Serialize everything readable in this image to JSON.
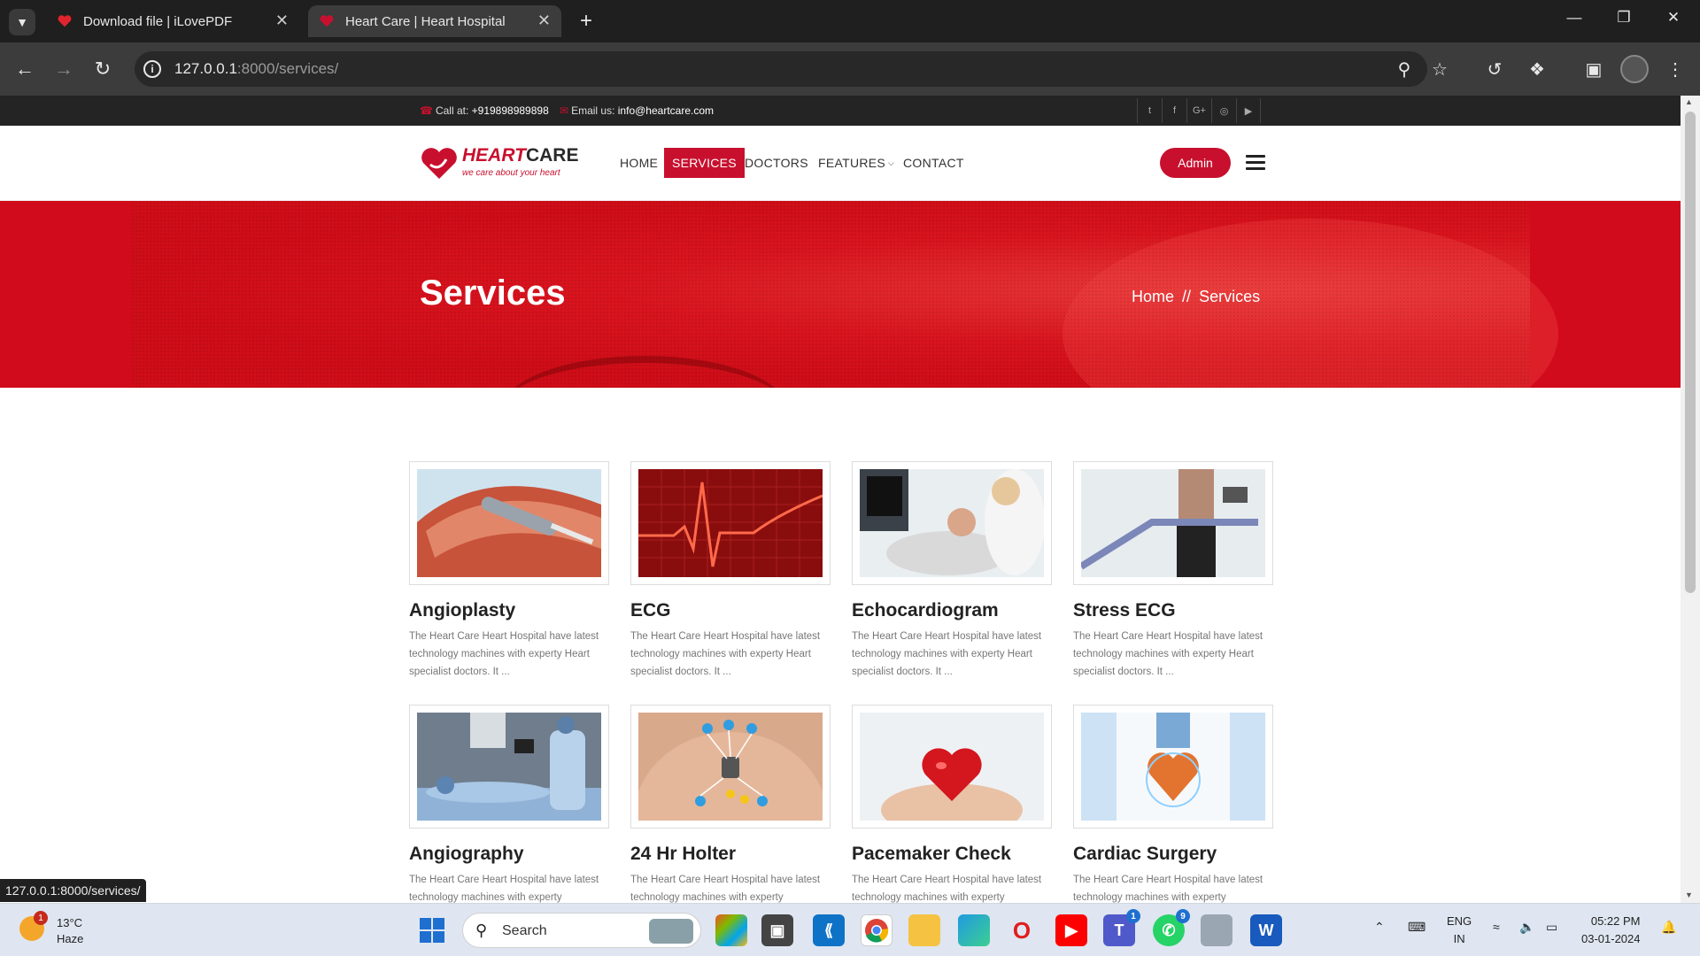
{
  "browser": {
    "tabs": [
      {
        "title": "Download file | iLovePDF",
        "active": false
      },
      {
        "title": "Heart Care | Heart Hospital",
        "active": true
      }
    ],
    "url_host": "127.0.0.1",
    "url_path": ":8000/services/",
    "status_url": "127.0.0.1:8000/services/"
  },
  "topbar": {
    "call_label": "Call at:",
    "call_number": "+919898989898",
    "email_label": "Email us:",
    "email": "info@heartcare.com",
    "social_icons": [
      "twitter-icon",
      "facebook-icon",
      "google-plus-icon",
      "instagram-icon",
      "youtube-icon"
    ]
  },
  "header": {
    "logo_heart": "HEART",
    "logo_care": "CARE",
    "logo_tagline": "we care about your heart",
    "menu": [
      {
        "label": "HOME",
        "active": false
      },
      {
        "label": "SERVICES",
        "active": true
      },
      {
        "label": "DOCTORS",
        "active": false
      },
      {
        "label": "FEATURES",
        "active": false,
        "dropdown": true
      },
      {
        "label": "CONTACT",
        "active": false
      }
    ],
    "admin_label": "Admin"
  },
  "banner": {
    "title": "Services",
    "breadcrumb_home": "Home",
    "breadcrumb_sep": "//",
    "breadcrumb_current": "Services"
  },
  "services": [
    {
      "name": "Angioplasty",
      "desc": "The Heart Care Heart Hospital have latest technology machines with experty Heart specialist doctors. It ...",
      "image": "stent-artery"
    },
    {
      "name": "ECG",
      "desc": "The Heart Care Heart Hospital have latest technology machines with experty Heart specialist doctors. It ...",
      "image": "ecg-waveform"
    },
    {
      "name": "Echocardiogram",
      "desc": "The Heart Care Heart Hospital have latest technology machines with experty Heart specialist doctors. It ...",
      "image": "echo-scan"
    },
    {
      "name": "Stress ECG",
      "desc": "The Heart Care Heart Hospital have latest technology machines with experty Heart specialist doctors. It ...",
      "image": "treadmill-test"
    },
    {
      "name": "Angiography",
      "desc": "The Heart Care Heart Hospital have latest technology machines with experty",
      "image": "angiography-lab"
    },
    {
      "name": "24 Hr Holter",
      "desc": "The Heart Care Heart Hospital have latest technology machines with experty",
      "image": "holter-monitor"
    },
    {
      "name": "Pacemaker Check",
      "desc": "The Heart Care Heart Hospital have latest technology machines with experty",
      "image": "heart-in-hands"
    },
    {
      "name": "Cardiac Surgery",
      "desc": "The Heart Care Heart Hospital have latest technology machines with experty",
      "image": "doctor-heart"
    }
  ],
  "taskbar": {
    "weather_badge": "1",
    "temperature": "13°C",
    "condition": "Haze",
    "search_label": "Search",
    "teams_badge": "1",
    "whatsapp_badge": "9",
    "lang_line1": "ENG",
    "lang_line2": "IN",
    "time": "05:22 PM",
    "date": "03-01-2024"
  },
  "colors": {
    "brand_red": "#c8102e",
    "topbar_bg": "#242424",
    "browser_bg": "#1f1f1f",
    "taskbar_bg": "#dfe6f1"
  }
}
